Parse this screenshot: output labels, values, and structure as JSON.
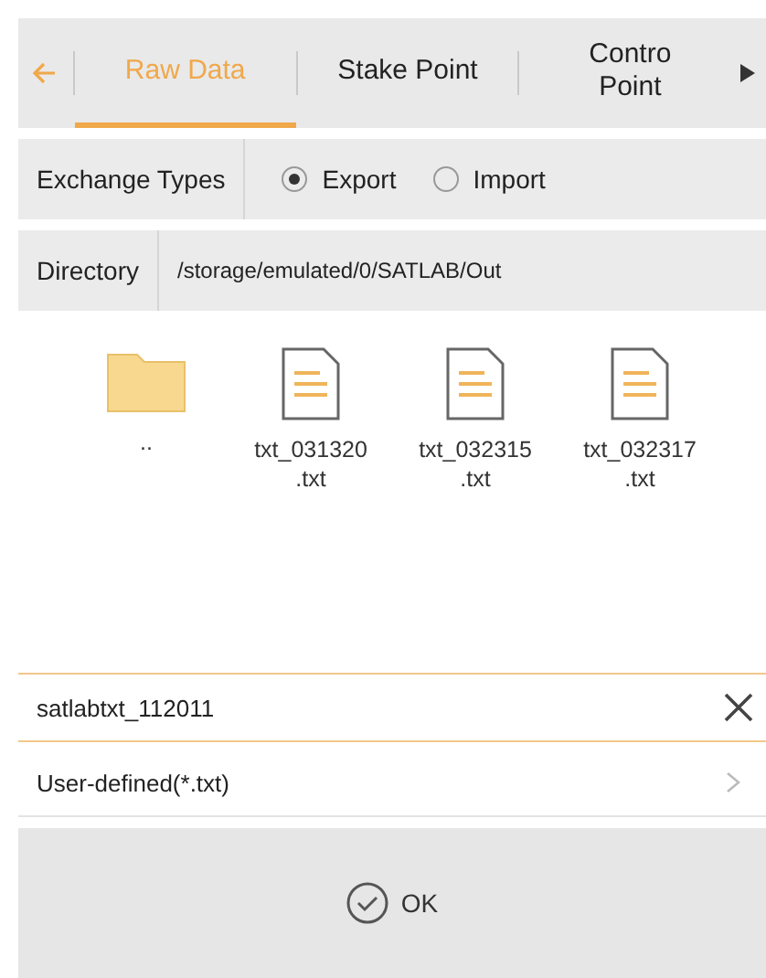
{
  "tabs": [
    {
      "label": "Raw Data",
      "selected": true
    },
    {
      "label": "Stake Point",
      "selected": false
    },
    {
      "label": "Contro Point",
      "selected": false
    }
  ],
  "exchange_types": {
    "label": "Exchange Types",
    "options": [
      {
        "label": "Export",
        "selected": true
      },
      {
        "label": "Import",
        "selected": false
      }
    ]
  },
  "directory": {
    "label": "Directory",
    "value": "/storage/emulated/0/SATLAB/Out"
  },
  "files": [
    {
      "kind": "folder",
      "name": ".."
    },
    {
      "kind": "file",
      "name": "txt_031320\n.txt"
    },
    {
      "kind": "file",
      "name": "txt_032315\n.txt"
    },
    {
      "kind": "file",
      "name": "txt_032317\n.txt"
    }
  ],
  "filename": {
    "value": "satlabtxt_112011"
  },
  "format": {
    "label": "User-defined(*.txt)"
  },
  "ok_button": {
    "label": "OK"
  }
}
